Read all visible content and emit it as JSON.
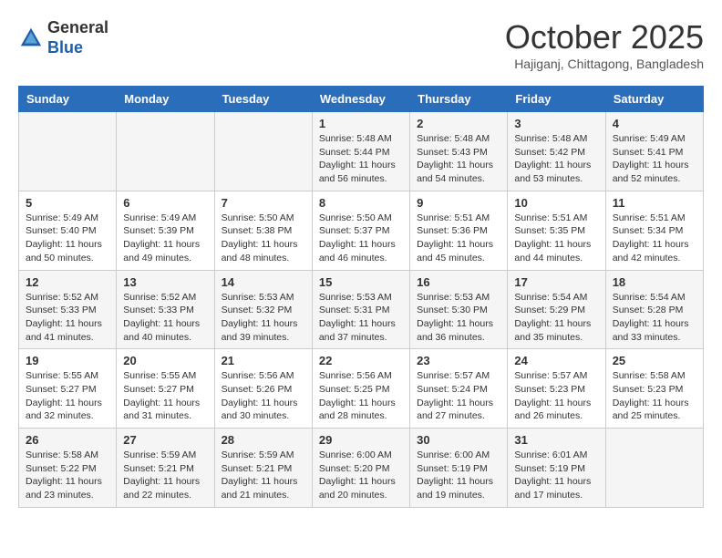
{
  "header": {
    "logo_general": "General",
    "logo_blue": "Blue",
    "month": "October 2025",
    "location": "Hajiganj, Chittagong, Bangladesh"
  },
  "weekdays": [
    "Sunday",
    "Monday",
    "Tuesday",
    "Wednesday",
    "Thursday",
    "Friday",
    "Saturday"
  ],
  "weeks": [
    [
      {
        "day": "",
        "info": ""
      },
      {
        "day": "",
        "info": ""
      },
      {
        "day": "",
        "info": ""
      },
      {
        "day": "1",
        "info": "Sunrise: 5:48 AM\nSunset: 5:44 PM\nDaylight: 11 hours\nand 56 minutes."
      },
      {
        "day": "2",
        "info": "Sunrise: 5:48 AM\nSunset: 5:43 PM\nDaylight: 11 hours\nand 54 minutes."
      },
      {
        "day": "3",
        "info": "Sunrise: 5:48 AM\nSunset: 5:42 PM\nDaylight: 11 hours\nand 53 minutes."
      },
      {
        "day": "4",
        "info": "Sunrise: 5:49 AM\nSunset: 5:41 PM\nDaylight: 11 hours\nand 52 minutes."
      }
    ],
    [
      {
        "day": "5",
        "info": "Sunrise: 5:49 AM\nSunset: 5:40 PM\nDaylight: 11 hours\nand 50 minutes."
      },
      {
        "day": "6",
        "info": "Sunrise: 5:49 AM\nSunset: 5:39 PM\nDaylight: 11 hours\nand 49 minutes."
      },
      {
        "day": "7",
        "info": "Sunrise: 5:50 AM\nSunset: 5:38 PM\nDaylight: 11 hours\nand 48 minutes."
      },
      {
        "day": "8",
        "info": "Sunrise: 5:50 AM\nSunset: 5:37 PM\nDaylight: 11 hours\nand 46 minutes."
      },
      {
        "day": "9",
        "info": "Sunrise: 5:51 AM\nSunset: 5:36 PM\nDaylight: 11 hours\nand 45 minutes."
      },
      {
        "day": "10",
        "info": "Sunrise: 5:51 AM\nSunset: 5:35 PM\nDaylight: 11 hours\nand 44 minutes."
      },
      {
        "day": "11",
        "info": "Sunrise: 5:51 AM\nSunset: 5:34 PM\nDaylight: 11 hours\nand 42 minutes."
      }
    ],
    [
      {
        "day": "12",
        "info": "Sunrise: 5:52 AM\nSunset: 5:33 PM\nDaylight: 11 hours\nand 41 minutes."
      },
      {
        "day": "13",
        "info": "Sunrise: 5:52 AM\nSunset: 5:33 PM\nDaylight: 11 hours\nand 40 minutes."
      },
      {
        "day": "14",
        "info": "Sunrise: 5:53 AM\nSunset: 5:32 PM\nDaylight: 11 hours\nand 39 minutes."
      },
      {
        "day": "15",
        "info": "Sunrise: 5:53 AM\nSunset: 5:31 PM\nDaylight: 11 hours\nand 37 minutes."
      },
      {
        "day": "16",
        "info": "Sunrise: 5:53 AM\nSunset: 5:30 PM\nDaylight: 11 hours\nand 36 minutes."
      },
      {
        "day": "17",
        "info": "Sunrise: 5:54 AM\nSunset: 5:29 PM\nDaylight: 11 hours\nand 35 minutes."
      },
      {
        "day": "18",
        "info": "Sunrise: 5:54 AM\nSunset: 5:28 PM\nDaylight: 11 hours\nand 33 minutes."
      }
    ],
    [
      {
        "day": "19",
        "info": "Sunrise: 5:55 AM\nSunset: 5:27 PM\nDaylight: 11 hours\nand 32 minutes."
      },
      {
        "day": "20",
        "info": "Sunrise: 5:55 AM\nSunset: 5:27 PM\nDaylight: 11 hours\nand 31 minutes."
      },
      {
        "day": "21",
        "info": "Sunrise: 5:56 AM\nSunset: 5:26 PM\nDaylight: 11 hours\nand 30 minutes."
      },
      {
        "day": "22",
        "info": "Sunrise: 5:56 AM\nSunset: 5:25 PM\nDaylight: 11 hours\nand 28 minutes."
      },
      {
        "day": "23",
        "info": "Sunrise: 5:57 AM\nSunset: 5:24 PM\nDaylight: 11 hours\nand 27 minutes."
      },
      {
        "day": "24",
        "info": "Sunrise: 5:57 AM\nSunset: 5:23 PM\nDaylight: 11 hours\nand 26 minutes."
      },
      {
        "day": "25",
        "info": "Sunrise: 5:58 AM\nSunset: 5:23 PM\nDaylight: 11 hours\nand 25 minutes."
      }
    ],
    [
      {
        "day": "26",
        "info": "Sunrise: 5:58 AM\nSunset: 5:22 PM\nDaylight: 11 hours\nand 23 minutes."
      },
      {
        "day": "27",
        "info": "Sunrise: 5:59 AM\nSunset: 5:21 PM\nDaylight: 11 hours\nand 22 minutes."
      },
      {
        "day": "28",
        "info": "Sunrise: 5:59 AM\nSunset: 5:21 PM\nDaylight: 11 hours\nand 21 minutes."
      },
      {
        "day": "29",
        "info": "Sunrise: 6:00 AM\nSunset: 5:20 PM\nDaylight: 11 hours\nand 20 minutes."
      },
      {
        "day": "30",
        "info": "Sunrise: 6:00 AM\nSunset: 5:19 PM\nDaylight: 11 hours\nand 19 minutes."
      },
      {
        "day": "31",
        "info": "Sunrise: 6:01 AM\nSunset: 5:19 PM\nDaylight: 11 hours\nand 17 minutes."
      },
      {
        "day": "",
        "info": ""
      }
    ]
  ]
}
